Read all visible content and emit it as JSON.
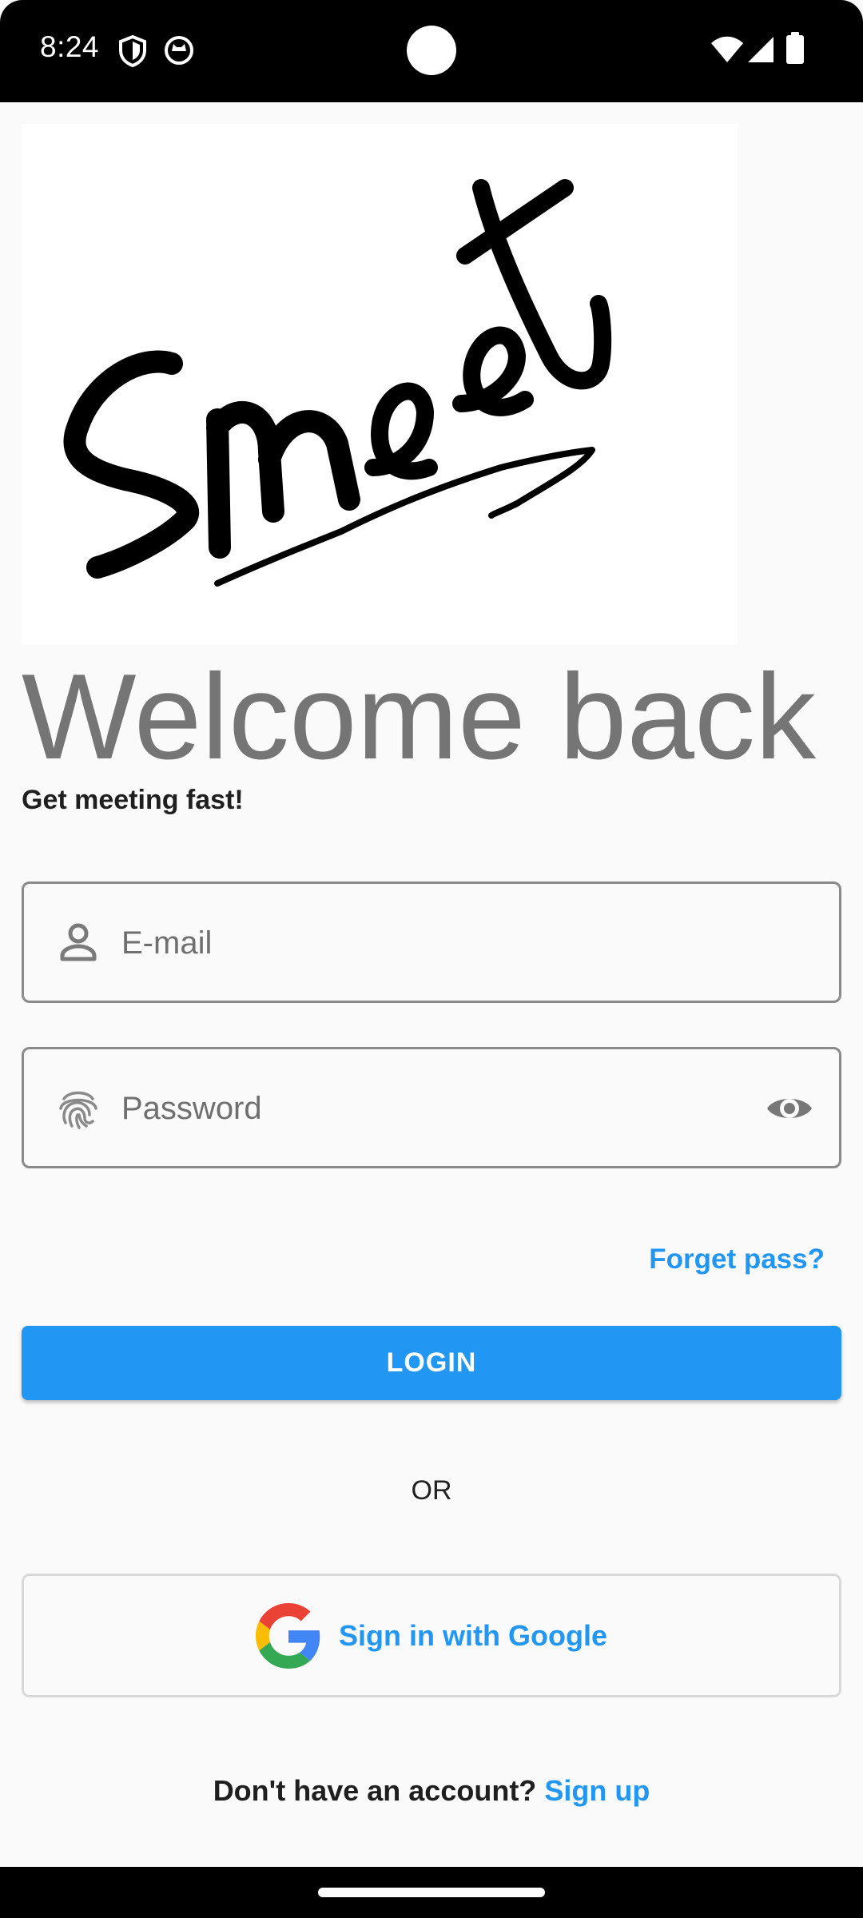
{
  "status_bar": {
    "time": "8:24",
    "icons": [
      "shield-icon",
      "cat-icon",
      "wifi-icon",
      "signal-icon",
      "battery-icon"
    ]
  },
  "logo": {
    "text": "Smeet",
    "icon": "handwritten-logo"
  },
  "header": {
    "title": "Welcome back",
    "subtitle": "Get meeting fast!"
  },
  "form": {
    "email": {
      "placeholder": "E-mail",
      "value": "",
      "icon": "person-icon"
    },
    "password": {
      "placeholder": "Password",
      "value": "",
      "icon": "fingerprint-icon",
      "toggle_icon": "eye-icon"
    },
    "forgot_label": "Forget pass?",
    "login_label": "LOGIN"
  },
  "divider": {
    "or_label": "OR"
  },
  "google": {
    "label": "Sign in with Google",
    "icon": "google-icon"
  },
  "signup": {
    "prompt": "Don't have an account?",
    "link_label": "Sign up"
  },
  "colors": {
    "accent": "#2196f3",
    "title_gray": "#757575",
    "background": "#fafafa",
    "status_bar": "#000000"
  }
}
